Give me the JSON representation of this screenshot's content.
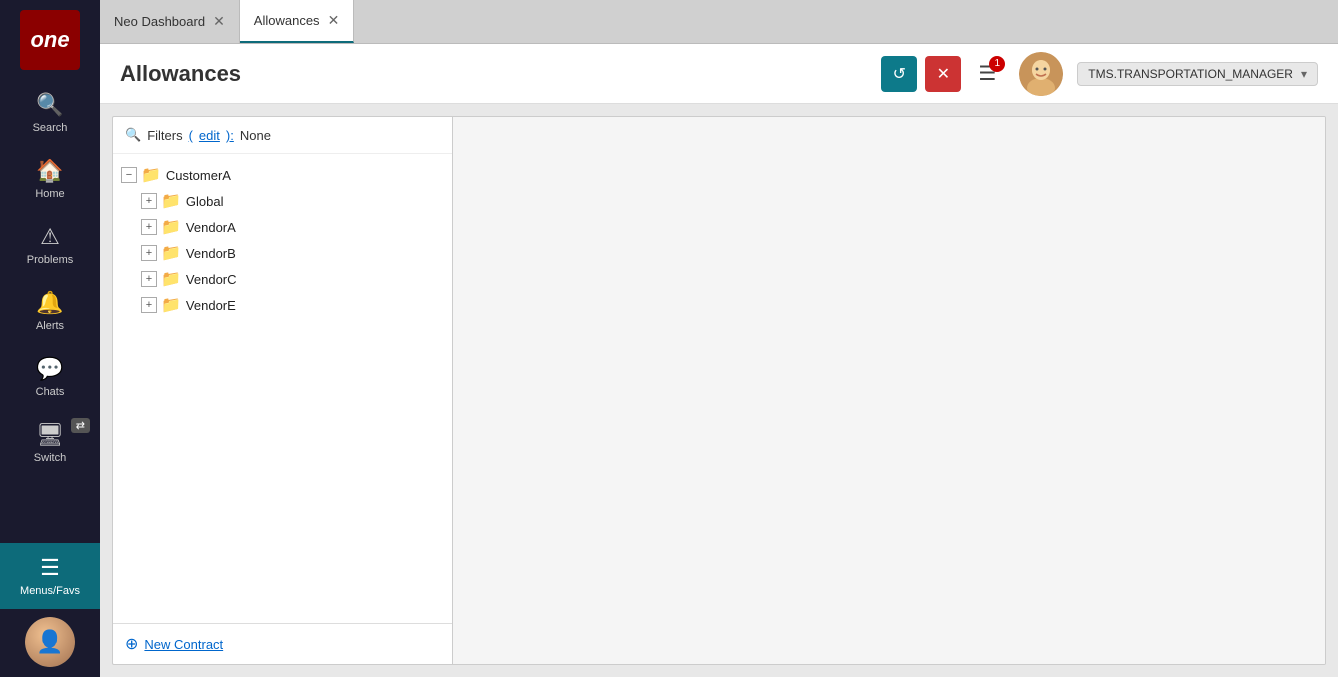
{
  "logo": {
    "text": "one"
  },
  "sidebar": {
    "items": [
      {
        "id": "search",
        "label": "Search",
        "icon": "🔍"
      },
      {
        "id": "home",
        "label": "Home",
        "icon": "🏠"
      },
      {
        "id": "problems",
        "label": "Problems",
        "icon": "⚠"
      },
      {
        "id": "alerts",
        "label": "Alerts",
        "icon": "🔔"
      },
      {
        "id": "chats",
        "label": "Chats",
        "icon": "💬"
      },
      {
        "id": "switch",
        "label": "Switch",
        "icon": "🖥"
      }
    ],
    "bottom": {
      "menus_favs_label": "Menus/Favs",
      "menus_icon": "☰"
    }
  },
  "tabs": [
    {
      "id": "neo-dashboard",
      "label": "Neo Dashboard",
      "closable": true,
      "active": false
    },
    {
      "id": "allowances",
      "label": "Allowances",
      "closable": true,
      "active": true
    }
  ],
  "header": {
    "title": "Allowances",
    "refresh_title": "Refresh",
    "close_title": "Close",
    "notification_icon": "☰",
    "user_name": "TMS.TRANSPORTATION_MANAGER"
  },
  "filters": {
    "label": "Filters",
    "edit_label": "edit",
    "value": "None"
  },
  "tree": {
    "root": {
      "label": "CustomerA",
      "children": [
        {
          "label": "Global",
          "children": []
        },
        {
          "label": "VendorA",
          "children": []
        },
        {
          "label": "VendorB",
          "children": []
        },
        {
          "label": "VendorC",
          "children": []
        },
        {
          "label": "VendorE",
          "children": []
        }
      ]
    }
  },
  "footer": {
    "new_contract_label": "New Contract"
  },
  "notification_count": "1"
}
